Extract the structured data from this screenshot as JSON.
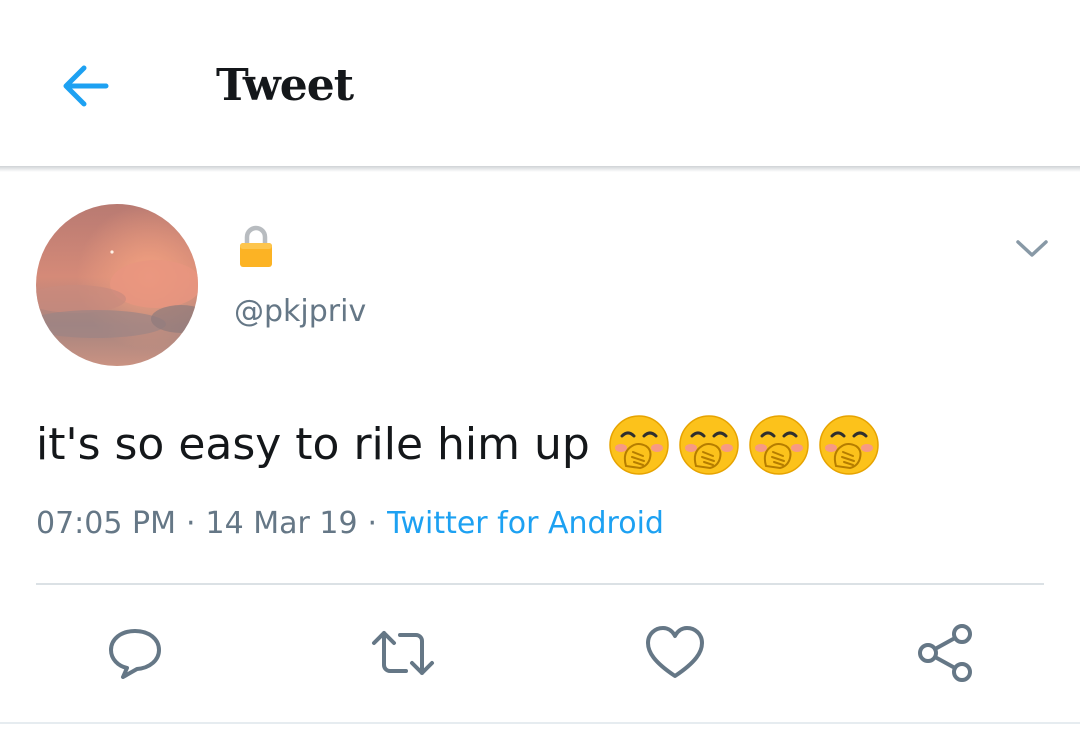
{
  "header": {
    "title": "Tweet",
    "back_icon": "arrow-left-icon"
  },
  "tweet": {
    "avatar_description_icon": "avatar",
    "lock_icon": "lock-icon",
    "handle": "@pkjpriv",
    "text": "it's so easy to rile him up",
    "emojis": [
      "hand-over-mouth-emoji",
      "hand-over-mouth-emoji",
      "hand-over-mouth-emoji",
      "hand-over-mouth-emoji"
    ],
    "time": "07:05 PM",
    "separator": "·",
    "date": "14 Mar 19",
    "source": "Twitter for Android"
  },
  "actions": {
    "reply_icon": "reply-icon",
    "retweet_icon": "retweet-icon",
    "like_icon": "heart-icon",
    "share_icon": "share-icon"
  },
  "colors": {
    "accent": "#1da1f2",
    "text": "#14171a",
    "secondary": "#657786",
    "icon": "#657786",
    "lock": "#f5a623"
  }
}
